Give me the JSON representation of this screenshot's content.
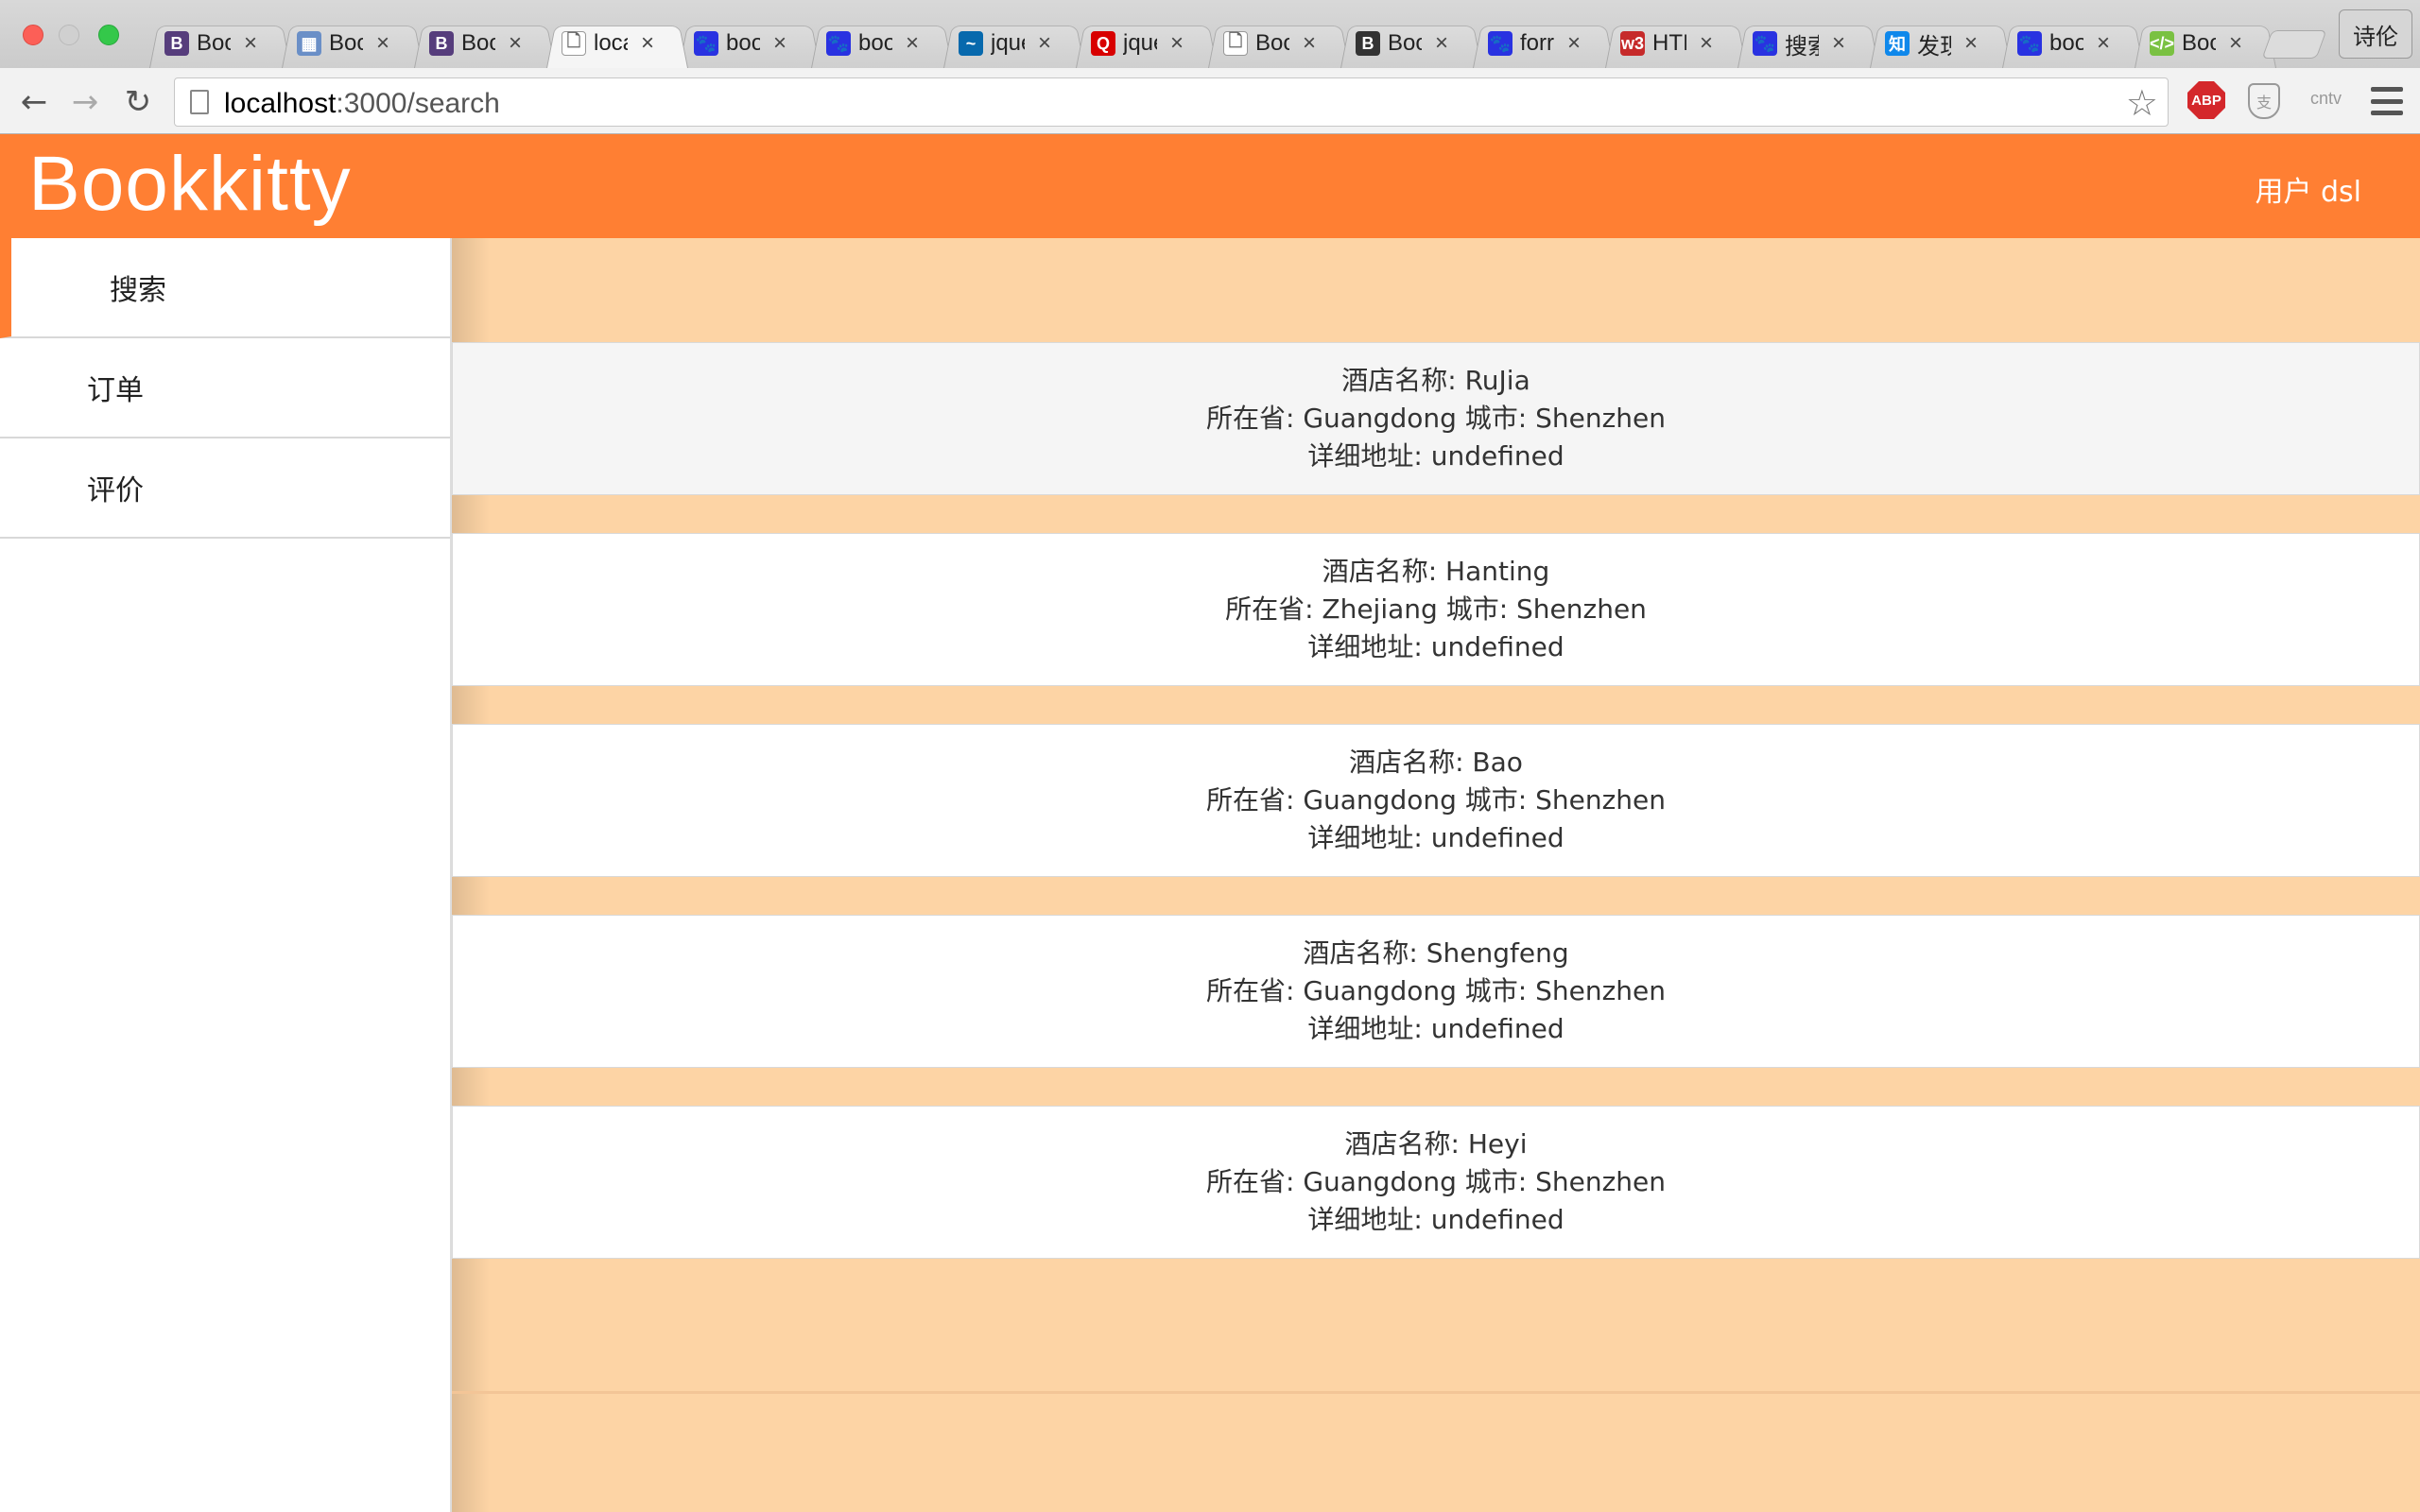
{
  "browser": {
    "tabs": [
      {
        "title": "Boo",
        "icon": "bootstrap-icon",
        "color": "#563d7c",
        "glyph": "B"
      },
      {
        "title": "Boo",
        "icon": "grid-icon",
        "color": "#6a8fc7",
        "glyph": "▦"
      },
      {
        "title": "Boo",
        "icon": "bootstrap-icon",
        "color": "#563d7c",
        "glyph": "B"
      },
      {
        "title": "loca",
        "icon": "page-icon",
        "color": "#ffffff",
        "glyph": "🗋",
        "active": true
      },
      {
        "title": "boo",
        "icon": "baidu-paw-icon",
        "color": "#2932e1",
        "glyph": "🐾"
      },
      {
        "title": "boo",
        "icon": "baidu-paw-icon",
        "color": "#2932e1",
        "glyph": "🐾"
      },
      {
        "title": "jque",
        "icon": "jquery-icon",
        "color": "#0769ad",
        "glyph": "~"
      },
      {
        "title": "jque",
        "icon": "quora-icon",
        "color": "#d80000",
        "glyph": "Q"
      },
      {
        "title": "Boo",
        "icon": "page-icon",
        "color": "#ffffff",
        "glyph": "🗋"
      },
      {
        "title": "Boo",
        "icon": "bootstrap-icon",
        "color": "#333333",
        "glyph": "B"
      },
      {
        "title": "forr",
        "icon": "baidu-paw-icon",
        "color": "#2932e1",
        "glyph": "🐾"
      },
      {
        "title": "HTI",
        "icon": "w3school-icon",
        "color": "#c62a2a",
        "glyph": "w3"
      },
      {
        "title": "搜索",
        "icon": "baidu-paw-icon",
        "color": "#2932e1",
        "glyph": "🐾"
      },
      {
        "title": "发现",
        "icon": "zhihu-icon",
        "color": "#0f88eb",
        "glyph": "知"
      },
      {
        "title": "boo",
        "icon": "baidu-paw-icon",
        "color": "#2932e1",
        "glyph": "🐾"
      },
      {
        "title": "Boo",
        "icon": "code-icon",
        "color": "#7ac142",
        "glyph": "</>"
      }
    ],
    "profile_name": "诗伦",
    "url_host": "localhost",
    "url_path": ":3000/search",
    "extensions": {
      "abp": "ABP",
      "cntv": "cntv"
    }
  },
  "app": {
    "brand": "Bookkitty",
    "user_label": "用户 dsl",
    "accent_color": "#ff7f33",
    "content_bg": "#fdd4a5"
  },
  "sidebar": {
    "items": [
      {
        "label": "搜索",
        "active": true
      },
      {
        "label": "订单",
        "active": false
      },
      {
        "label": "评价",
        "active": false
      }
    ]
  },
  "hotels": [
    {
      "name_line": "酒店名称: RuJia",
      "location_line": "所在省: Guangdong 城市: Shenzhen",
      "address_line": "详细地址: undefined"
    },
    {
      "name_line": "酒店名称: Hanting",
      "location_line": "所在省: Zhejiang 城市: Shenzhen",
      "address_line": "详细地址: undefined"
    },
    {
      "name_line": "酒店名称: Bao",
      "location_line": "所在省: Guangdong 城市: Shenzhen",
      "address_line": "详细地址: undefined"
    },
    {
      "name_line": "酒店名称: Shengfeng",
      "location_line": "所在省: Guangdong 城市: Shenzhen",
      "address_line": "详细地址: undefined"
    },
    {
      "name_line": "酒店名称: Heyi",
      "location_line": "所在省: Guangdong 城市: Shenzhen",
      "address_line": "详细地址: undefined"
    }
  ]
}
